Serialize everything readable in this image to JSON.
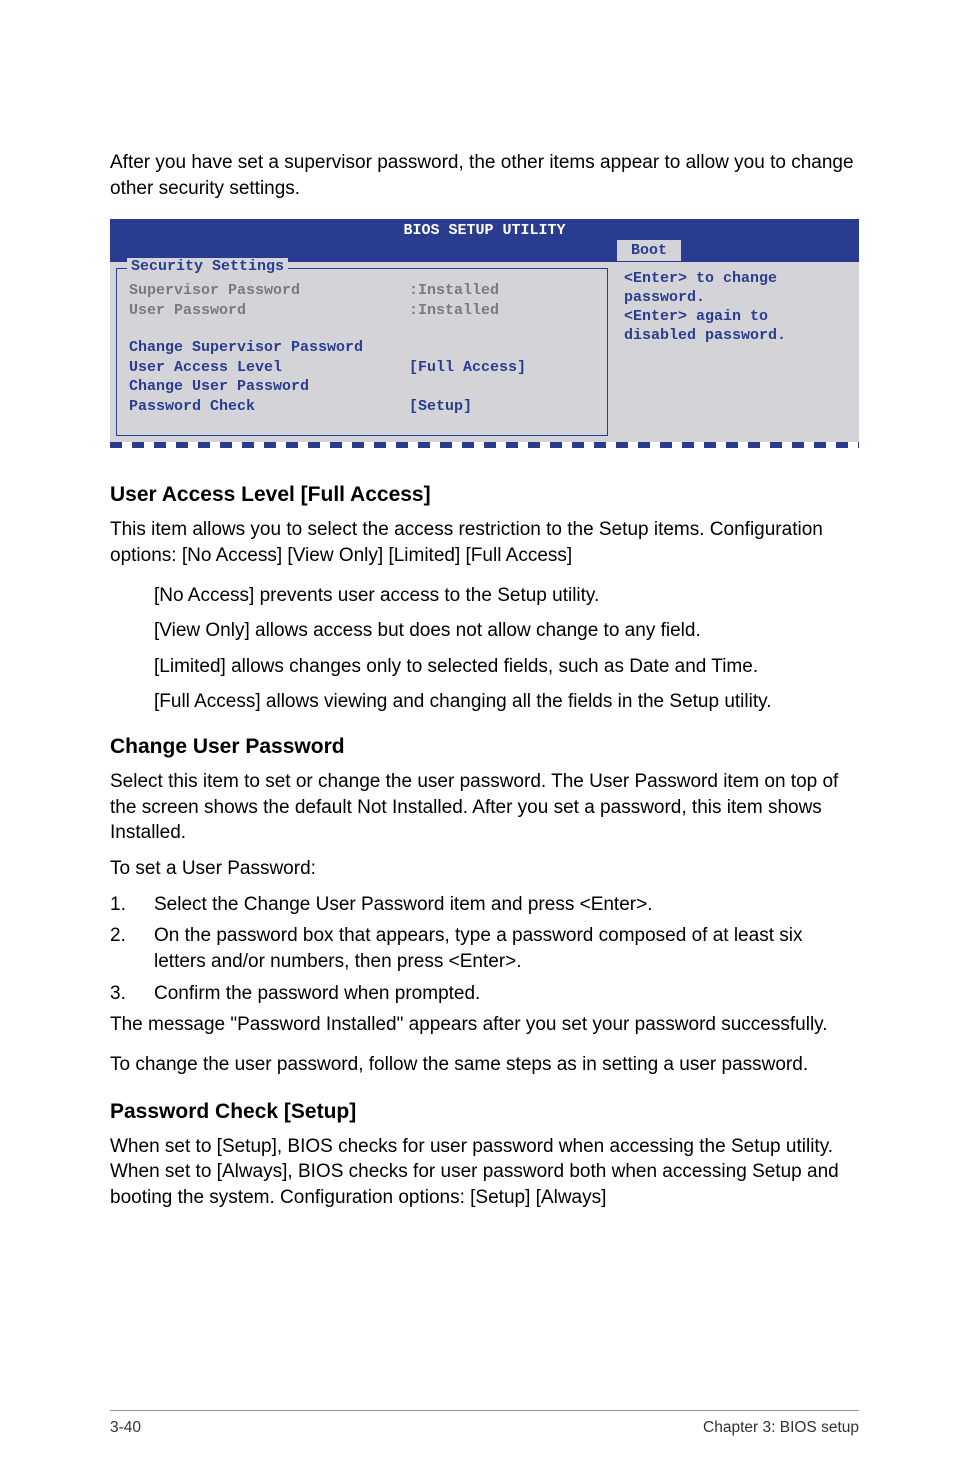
{
  "intro": "After you have set a supervisor password, the other items appear to allow you to change other security settings.",
  "bios": {
    "title": "BIOS SETUP UTILITY",
    "tab": "Boot",
    "sectionTitle": "Security Settings",
    "rows": {
      "supervisorLabel": "Supervisor Password",
      "supervisorValue": ":Installed",
      "userLabel": "User Password",
      "userValue": ":Installed",
      "changeSupervisor": "Change Supervisor Password",
      "accessLevelLabel": "User Access Level",
      "accessLevelValue": "[Full Access]",
      "changeUser": "Change User Password",
      "passwordCheckLabel": "Password Check",
      "passwordCheckValue": "[Setup]"
    },
    "help": {
      "line1": "<Enter> to change",
      "line2": "password.",
      "line3": "<Enter> again to",
      "line4": "disabled password."
    }
  },
  "userAccess": {
    "heading": "User Access Level [Full Access]",
    "desc": "This item allows you to select the access restriction to the Setup items. Configuration options: [No Access] [View Only] [Limited] [Full Access]",
    "noAccess": "[No Access] prevents user access to the Setup utility.",
    "viewOnly": "[View Only] allows access but does not allow change to any field.",
    "limited": "[Limited] allows changes only to selected fields, such as Date and Time.",
    "fullAccess": "[Full Access] allows viewing and changing all the fields in the Setup utility."
  },
  "changeUser": {
    "heading": "Change User Password",
    "desc": "Select this item to set or change the user password. The User Password item on top of the screen shows the default Not Installed. After you set a password, this item shows Installed.",
    "toSet": "To set a User Password:",
    "steps": {
      "s1": "Select the Change User Password item and press <Enter>.",
      "s2": "On the password box that appears, type a password composed of at least six letters and/or numbers, then press <Enter>.",
      "s3": "Confirm the password when prompted."
    },
    "success": "The message \"Password Installed\" appears after you set your password successfully.",
    "toChange": "To change the user password, follow the same steps as in setting a user password."
  },
  "passwordCheck": {
    "heading": "Password Check [Setup]",
    "desc": "When set to [Setup], BIOS checks for user password when accessing the Setup utility. When set to [Always], BIOS checks for user password both when accessing Setup and booting the system. Configuration options: [Setup] [Always]"
  },
  "footer": {
    "left": "3-40",
    "right": "Chapter 3: BIOS setup"
  }
}
